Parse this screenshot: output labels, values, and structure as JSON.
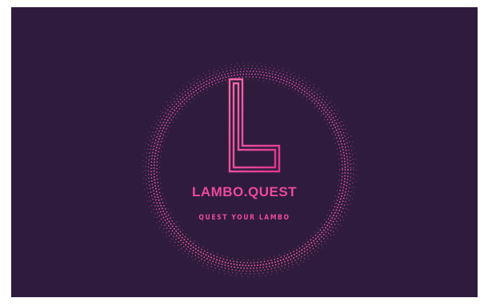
{
  "brand": {
    "name": "LAMBO.QUEST",
    "tagline": "QUEST YOUR LAMBO"
  },
  "colors": {
    "background": "#2f1c3c",
    "accent_pink": "#ec4a9a",
    "accent_magenta": "#d23aa6"
  },
  "icons": {
    "monogram": "letter-l-monogram-icon",
    "ring": "dotted-ring-icon"
  }
}
